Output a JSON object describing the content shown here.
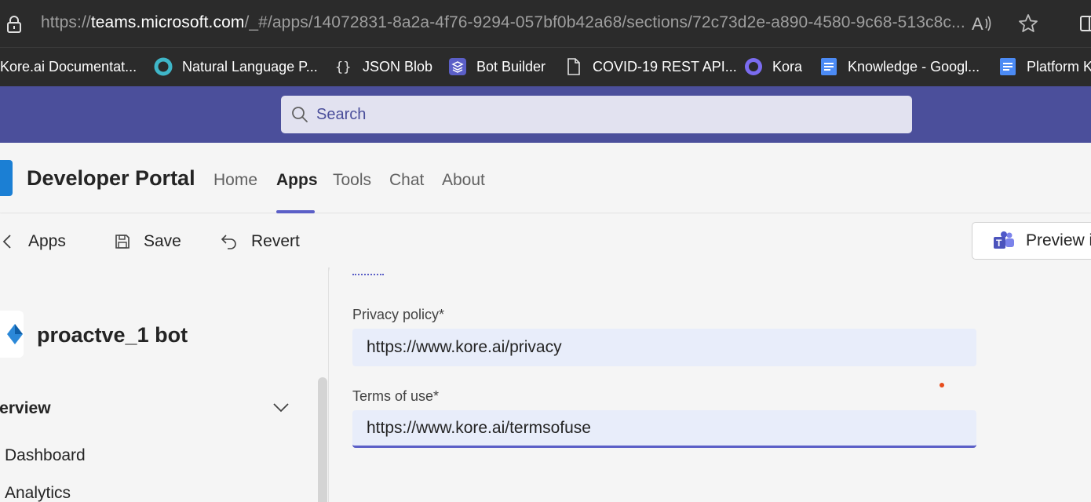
{
  "browser": {
    "url_prefix": "https://",
    "url_host": "teams.microsoft.com",
    "url_path": "/_#/apps/14072831-8a2a-4f76-9294-057bf0b42a68/sections/72c73d2e-a890-4580-9c68-513c8c...",
    "icons": [
      "lock-icon",
      "read-aloud-icon",
      "favorite-star-icon",
      "split-screen-icon"
    ]
  },
  "bookmarks": [
    {
      "label": "Kore.ai Documentat...",
      "icon": "none"
    },
    {
      "label": "Natural Language P...",
      "icon": "ring-icon"
    },
    {
      "label": "JSON Blob",
      "icon": "braces-icon"
    },
    {
      "label": "Bot Builder",
      "icon": "layers-icon"
    },
    {
      "label": "COVID-19 REST API...",
      "icon": "page-icon"
    },
    {
      "label": "Kora",
      "icon": "circle-icon"
    },
    {
      "label": "Knowledge - Googl...",
      "icon": "doc-icon"
    },
    {
      "label": "Platform K",
      "icon": "doc-icon"
    }
  ],
  "teams": {
    "search_placeholder": "Search"
  },
  "portal": {
    "title": "Developer Portal",
    "nav": [
      "Home",
      "Apps",
      "Tools",
      "Chat",
      "About"
    ],
    "active_nav": "Apps"
  },
  "toolbar": {
    "back_label": "Apps",
    "save_label": "Save",
    "revert_label": "Revert",
    "preview_label": "Preview i"
  },
  "sidebar": {
    "app_name": "proactve_1 bot",
    "section_label": "rerview",
    "items": [
      "Dashboard",
      "Analytics"
    ]
  },
  "form": {
    "privacy_label": "Privacy policy*",
    "privacy_value": "https://www.kore.ai/privacy",
    "terms_label": "Terms of use*",
    "terms_value": "https://www.kore.ai/termsofuse"
  },
  "colors": {
    "teams_purple": "#4b4f9b",
    "accent": "#5b5fc7",
    "browser_bg": "#2b2b2b",
    "field_bg": "#e8edfa"
  }
}
